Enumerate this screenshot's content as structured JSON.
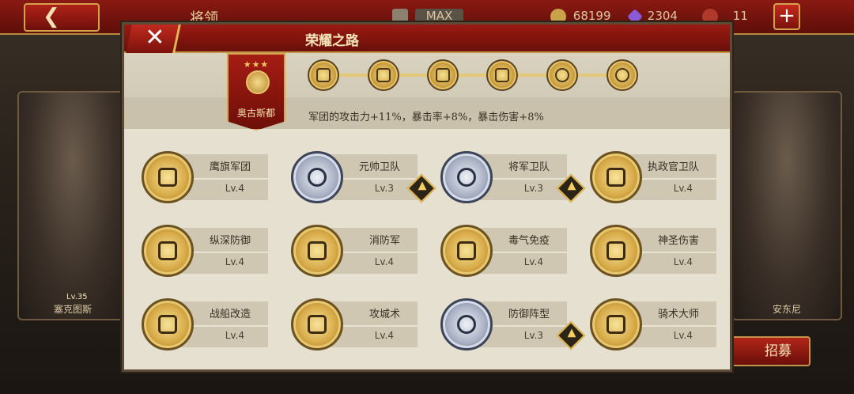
{
  "background": {
    "title": "将领",
    "resources": [
      {
        "icon": "building-icon",
        "value": "MAX",
        "color": "#8c8070"
      },
      {
        "icon": "gold-coin-icon",
        "value": "68199",
        "color": "#c9a24a"
      },
      {
        "icon": "purple-gem-icon",
        "value": "2304",
        "color": "#8a5ad8"
      },
      {
        "icon": "helmet-icon",
        "value": "11",
        "color": "#b03a2a"
      }
    ],
    "hero_left": {
      "name": "塞克图斯",
      "level": "Lv.35"
    },
    "hero_right": {
      "name": "安东尼"
    },
    "recruit_label": "招募"
  },
  "modal": {
    "title": "荣耀之路",
    "banner_label": "奥古斯都",
    "path_nodes": [
      "horse-rider-icon",
      "shield-icon",
      "eagle-standard-icon",
      "fasces-icon",
      "compass-cross-icon",
      "knight-horse-icon"
    ],
    "description": "军团的攻击力+11%，暴击率+8%，暴击伤害+8%",
    "skills": [
      {
        "name": "鹰旗军团",
        "level": "Lv.4",
        "medal": "gold",
        "icon": "eagle-standard-icon",
        "upgrade": false
      },
      {
        "name": "元帅卫队",
        "level": "Lv.3",
        "medal": "silver",
        "icon": "helmet-shield-icon",
        "upgrade": true
      },
      {
        "name": "将军卫队",
        "level": "Lv.3",
        "medal": "silver",
        "icon": "sword-shield-icon",
        "upgrade": true
      },
      {
        "name": "执政官卫队",
        "level": "Lv.4",
        "medal": "gold",
        "icon": "horse-shield-icon",
        "upgrade": false
      },
      {
        "name": "纵深防御",
        "level": "Lv.4",
        "medal": "gold",
        "icon": "rampart-icon",
        "upgrade": false
      },
      {
        "name": "消防军",
        "level": "Lv.4",
        "medal": "gold",
        "icon": "fire-icon",
        "upgrade": false
      },
      {
        "name": "毒气免疫",
        "level": "Lv.4",
        "medal": "gold",
        "icon": "mask-icon",
        "upgrade": false
      },
      {
        "name": "神圣伤害",
        "level": "Lv.4",
        "medal": "gold",
        "icon": "holy-star-icon",
        "upgrade": false
      },
      {
        "name": "战船改造",
        "level": "Lv.4",
        "medal": "gold",
        "icon": "ship-gear-icon",
        "upgrade": false
      },
      {
        "name": "攻城术",
        "level": "Lv.4",
        "medal": "gold",
        "icon": "siege-tower-icon",
        "upgrade": false
      },
      {
        "name": "防御阵型",
        "level": "Lv.3",
        "medal": "silver",
        "icon": "shield-formation-icon",
        "upgrade": true
      },
      {
        "name": "骑术大师",
        "level": "Lv.4",
        "medal": "gold",
        "icon": "rider-icon",
        "upgrade": false
      }
    ]
  }
}
